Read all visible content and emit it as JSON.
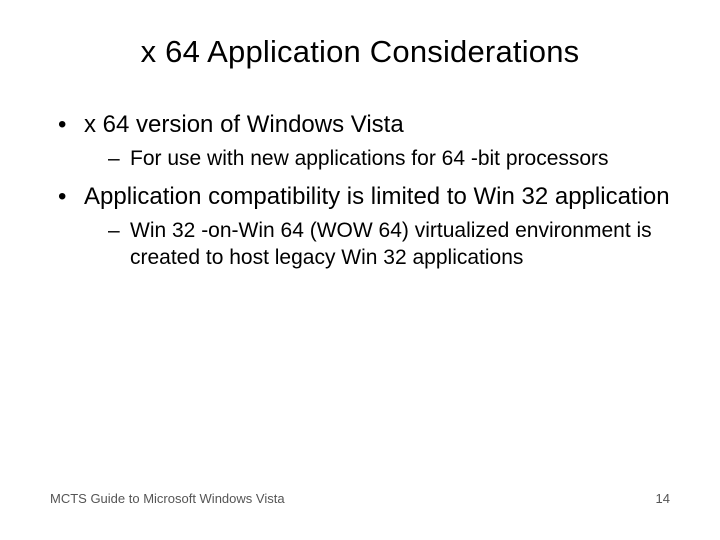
{
  "title": "x 64 Application Considerations",
  "bullets": {
    "b1": "x 64 version of Windows Vista",
    "b1_1": "For use with new applications for 64 -bit processors",
    "b2": "Application compatibility is limited to Win 32 application",
    "b2_1": "Win 32 -on-Win 64 (WOW 64) virtualized environment is created to host legacy Win 32 applications"
  },
  "footer": {
    "source": "MCTS Guide to Microsoft Windows Vista",
    "page": "14"
  }
}
